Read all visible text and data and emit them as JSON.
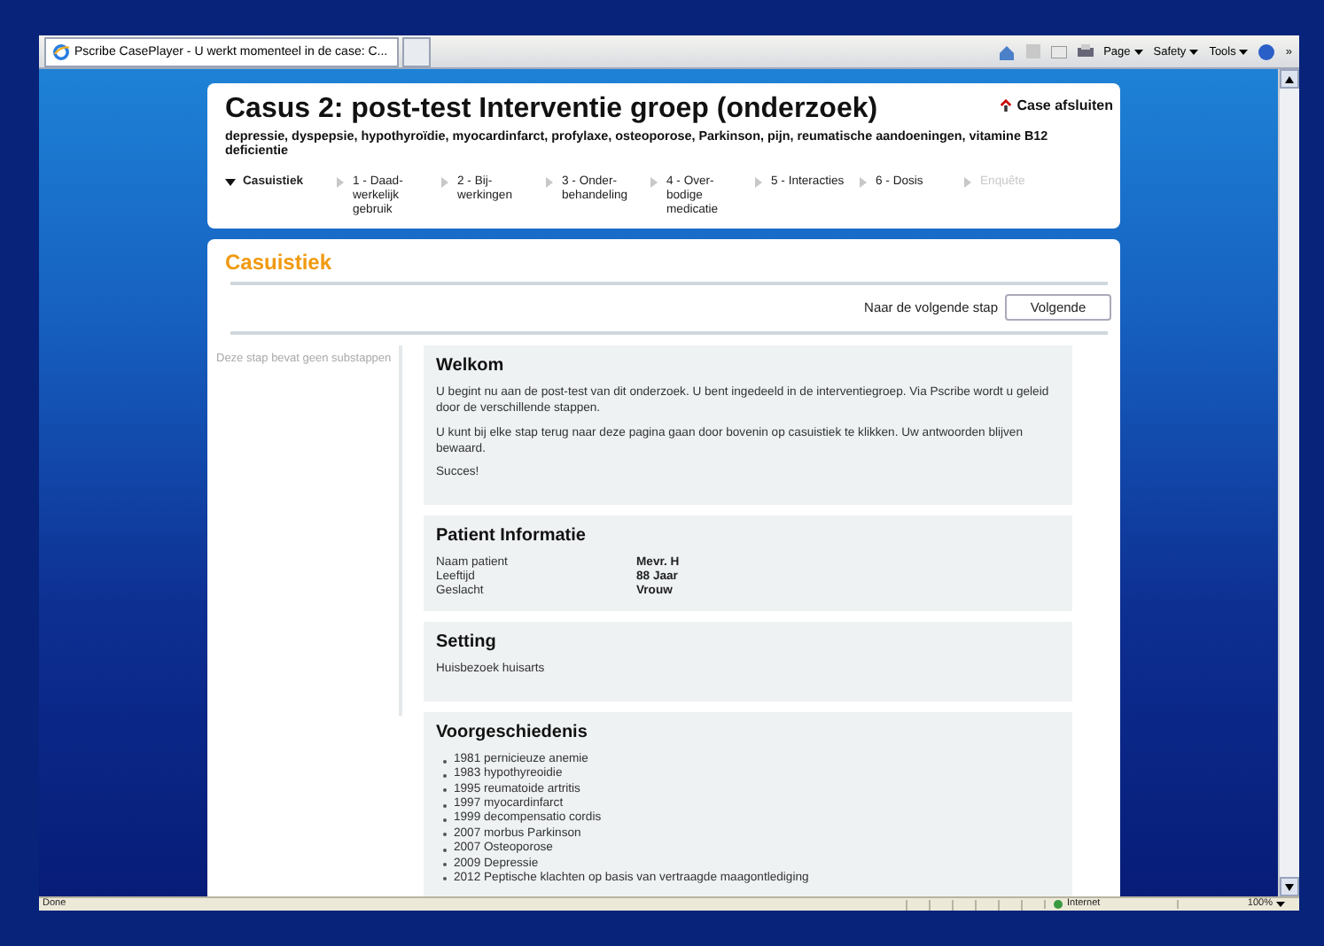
{
  "browser": {
    "tab_title": "Pscribe CasePlayer - U werkt momenteel in de case: C...",
    "toolbar": [
      "Page",
      "Safety",
      "Tools"
    ],
    "more": "»"
  },
  "header": {
    "title": "Casus 2: post-test Interventie groep (onderzoek)",
    "subtitle": "depressie, dyspepsie, hypothyroïdie, myocardinfarct, profylaxe, osteoporose, Parkinson, pijn, reumatische aandoeningen, vitamine B12 deficientie",
    "close": "Case afsluiten"
  },
  "steps": [
    {
      "lines": [
        "Casuistiek"
      ],
      "selected": true,
      "disabled": false
    },
    {
      "lines": [
        "1 - Daad-",
        "werkelijk",
        "gebruik"
      ],
      "selected": false,
      "disabled": false
    },
    {
      "lines": [
        "2 - Bij-",
        "werkingen"
      ],
      "selected": false,
      "disabled": false
    },
    {
      "lines": [
        "3 - Onder-",
        "behandeling"
      ],
      "selected": false,
      "disabled": false
    },
    {
      "lines": [
        "4 - Over-",
        "bodige",
        "medicatie"
      ],
      "selected": false,
      "disabled": false
    },
    {
      "lines": [
        "5 - Interacties"
      ],
      "selected": false,
      "disabled": false
    },
    {
      "lines": [
        "6 - Dosis"
      ],
      "selected": false,
      "disabled": false
    },
    {
      "lines": [
        "Enquête"
      ],
      "selected": false,
      "disabled": true
    }
  ],
  "section": {
    "title": "Casuistiek",
    "next_label": "Naar de volgende stap",
    "next_button": "Volgende",
    "sidebar_note": "Deze stap bevat geen substappen"
  },
  "panels": [
    {
      "kind": "text",
      "title": "Welkom",
      "paragraphs": [
        "U begint nu aan de post-test van dit onderzoek. U bent ingedeeld in de interventiegroep. Via Pscribe wordt u geleid door de verschillende stappen.",
        "U kunt bij elke stap terug naar deze pagina gaan door bovenin op casuistiek te klikken. Uw antwoorden blijven bewaard.",
        "Succes!"
      ]
    },
    {
      "kind": "fields",
      "title": "Patient Informatie",
      "fields": [
        {
          "label": "Naam patient",
          "value": "Mevr. H"
        },
        {
          "label": "Leeftijd",
          "value": "88 Jaar"
        },
        {
          "label": "Geslacht",
          "value": "Vrouw"
        }
      ]
    },
    {
      "kind": "text",
      "title": "Setting",
      "paragraphs": [
        "Huisbezoek huisarts"
      ]
    },
    {
      "kind": "list",
      "title": "Voorgeschiedenis",
      "items": [
        "1981 pernicieuze anemie",
        "1983 hypothyreoidie",
        "1995 reumatoide artritis",
        "1997 myocardinfarct",
        "1999 decompensatio cordis",
        "2007 morbus Parkinson",
        "2007 Osteoporose",
        "2009 Depressie",
        "2012 Peptische klachten op basis van vertraagde maagontlediging"
      ]
    }
  ],
  "status": {
    "left": "Done",
    "zone": "Internet",
    "zoom": "100%"
  }
}
